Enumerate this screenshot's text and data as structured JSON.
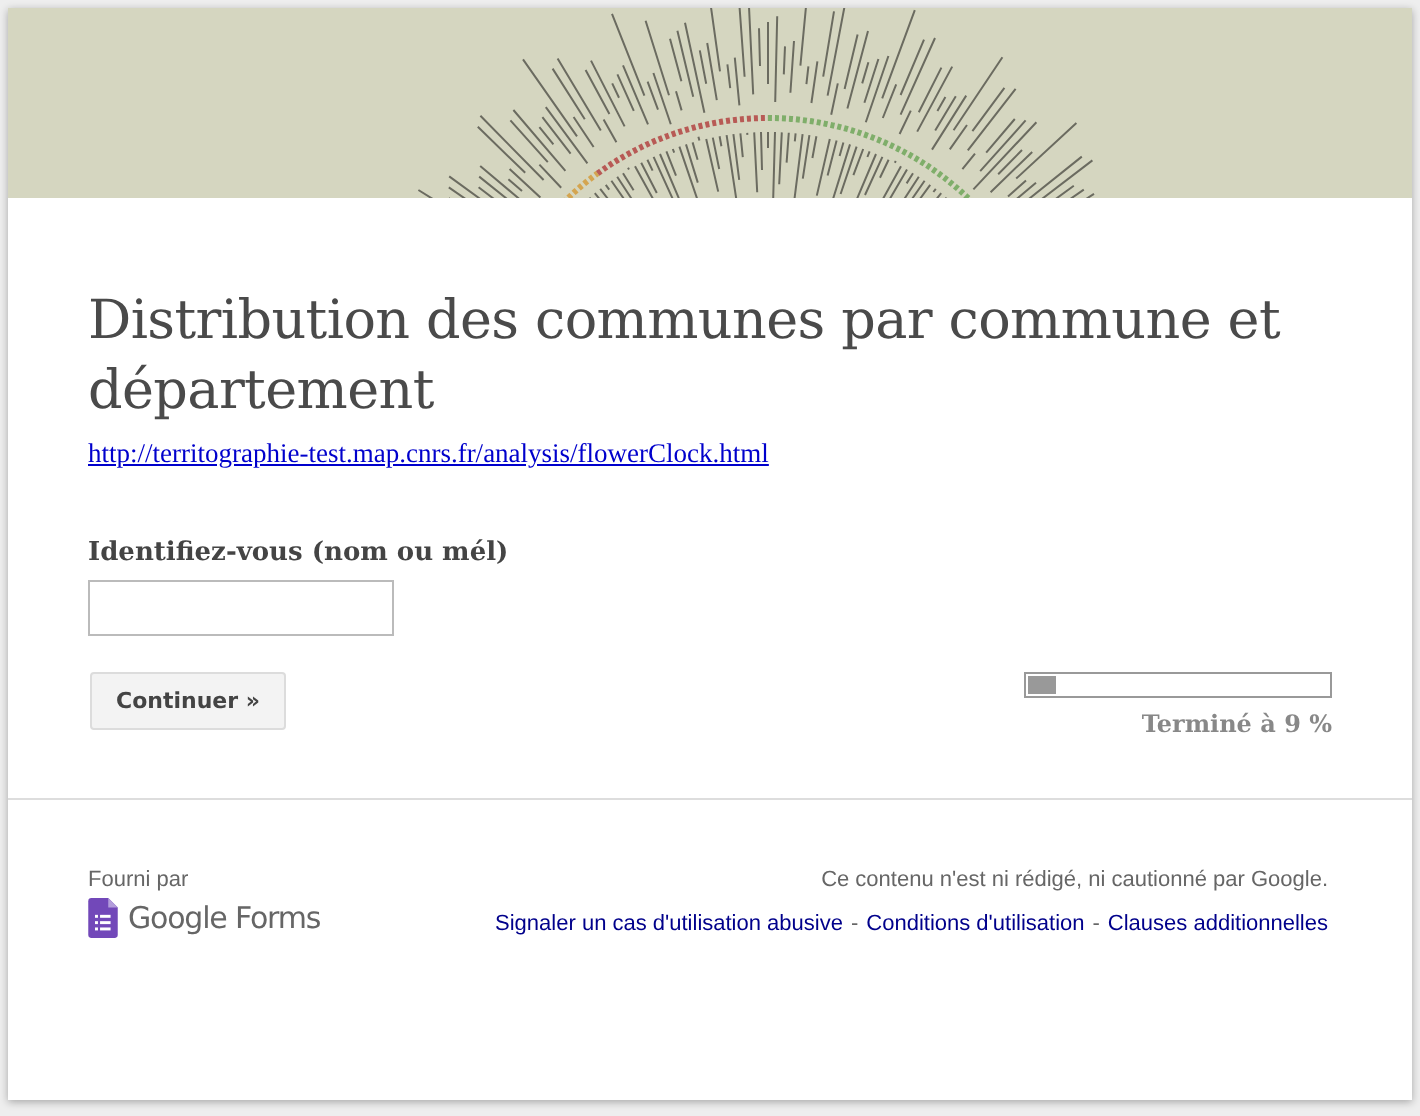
{
  "form": {
    "title": "Distribution des communes par commune et département",
    "link": "http://territographie-test.map.cnrs.fr/analysis/flowerClock.html",
    "question": {
      "label": "Identifiez-vous (nom ou mél)"
    },
    "continue_button": "Continuer »",
    "progress": {
      "level": 0.09,
      "label": "Terminé à 9 %"
    }
  },
  "footer": {
    "provided_by": "Fourni par",
    "product": "Google Forms",
    "disclaimer": "Ce contenu n'est ni rédigé, ni cautionné par Google.",
    "separator": "-",
    "links": [
      "Signaler un cas d'utilisation abusive",
      "Conditions d'utilisation",
      "Clauses additionnelles"
    ]
  }
}
